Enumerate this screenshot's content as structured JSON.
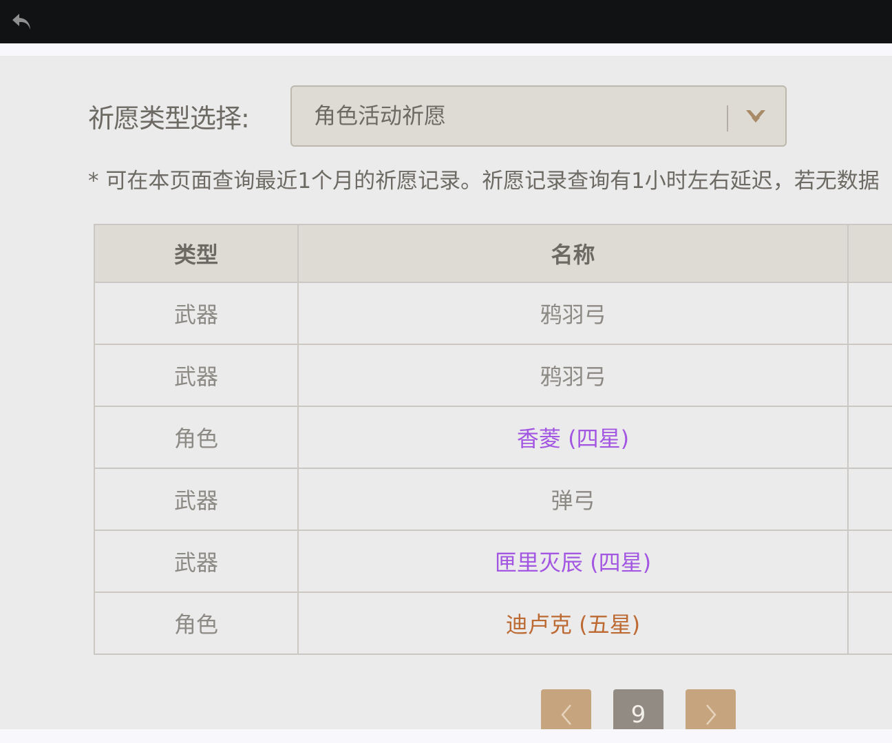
{
  "header": {
    "back_icon": "back-arrow-icon"
  },
  "filter": {
    "label": "祈愿类型选择:",
    "selected": "角色活动祈愿",
    "dropdown_icon": "chevron-down-icon"
  },
  "notice": "* 可在本页面查询最近1个月的祈愿记录。祈愿记录查询有1小时左右延迟，若无数据",
  "table": {
    "columns": [
      "类型",
      "名称",
      ""
    ],
    "rows": [
      {
        "type": "武器",
        "name": "鸦羽弓",
        "color": "#8d8a85"
      },
      {
        "type": "武器",
        "name": "鸦羽弓",
        "color": "#8d8a85"
      },
      {
        "type": "角色",
        "name": "香菱 (四星)",
        "color": "#a256e1"
      },
      {
        "type": "武器",
        "name": "弹弓",
        "color": "#8d8a85"
      },
      {
        "type": "武器",
        "name": "匣里灭辰 (四星)",
        "color": "#a256e1"
      },
      {
        "type": "角色",
        "name": "迪卢克 (五星)",
        "color": "#bd6932"
      }
    ]
  },
  "pagination": {
    "prev_icon": "chevron-left-icon",
    "current_page": "9",
    "next_icon": "chevron-right-icon"
  },
  "colors": {
    "four_star": "#a256e1",
    "five_star": "#bd6932",
    "pager_button": "#c6a47d",
    "pager_current": "#928b83"
  }
}
